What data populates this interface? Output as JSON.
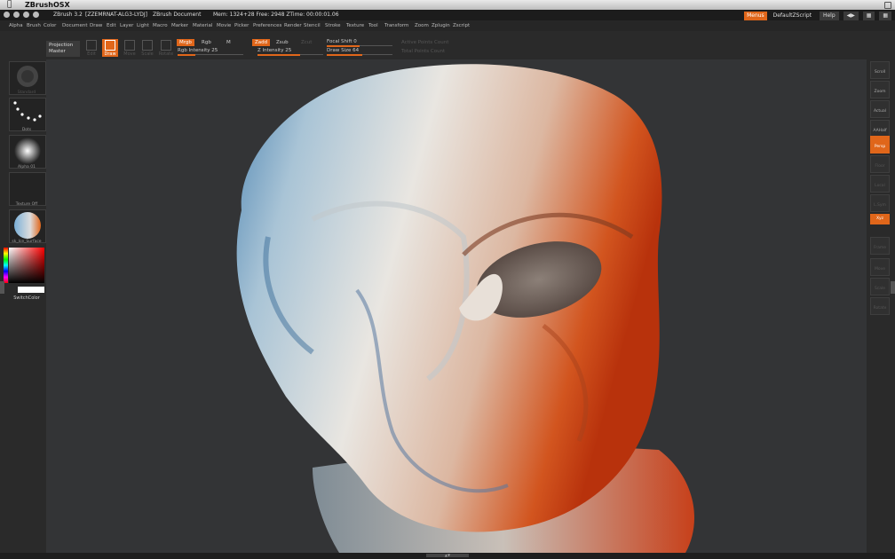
{
  "os": {
    "app_name": "ZBrushOSX"
  },
  "titlebar": {
    "app_version": "ZBrush 3.2",
    "license": "[ZZEMRNAT-ALG3-LYDJ]",
    "document": "ZBrush Document",
    "mem": "Mem: 1324+28  Free: 2948  ZTime: 00:00:01.06",
    "menus_btn": "Menus",
    "script_btn": "DefaultZScript",
    "help_btn": "Help"
  },
  "menubar": [
    "Alpha",
    "Brush",
    "Color",
    "Document",
    "Draw",
    "Edit",
    "Layer",
    "Light",
    "Macro",
    "Marker",
    "Material",
    "Movie",
    "Picker",
    "Preferences",
    "Render",
    "Stencil",
    "Stroke",
    "Texture",
    "Tool",
    "Transform",
    "Zoom",
    "Zplugin",
    "Zscript"
  ],
  "topshelf": {
    "projection_label": "Projection",
    "projection_sub": "Master",
    "tools": [
      "Edit",
      "Draw",
      "Move",
      "Scale",
      "Rotate"
    ],
    "mrgb": "Mrgb",
    "rgb": "Rgb",
    "m": "M",
    "zadd": "Zadd",
    "zsub": "Zsub",
    "zcut": "Zcut",
    "rgb_intensity": "Rgb Intensity 25",
    "z_intensity": "Z Intensity 25",
    "focal_shift": "Focal Shift 0",
    "draw_size": "Draw Size 64",
    "active_points": "Active Points Count",
    "total_points": "Total Points Count"
  },
  "leftshelf": {
    "standard": "Standard",
    "dots": "Dots",
    "alpha": "Alpha 01",
    "texture": "Texture  Off",
    "material": "sk_Ice_Surface",
    "switch_color": "SwitchColor"
  },
  "rightshelf": [
    "Scroll",
    "Zoom",
    "Actual",
    "AAHalf",
    "Persp",
    "Floor",
    "Local",
    "L.Sym",
    "Xyz",
    "",
    "",
    "Frame",
    "Move",
    "Scale",
    "Rotate"
  ],
  "colors": {
    "accent": "#e0661a"
  }
}
